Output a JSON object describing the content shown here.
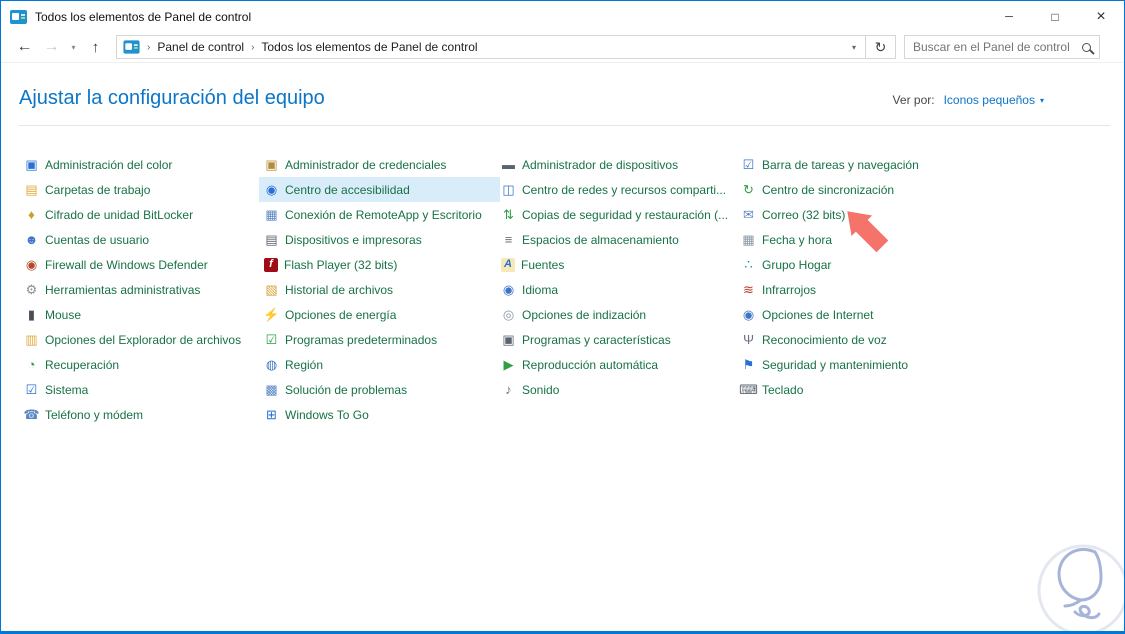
{
  "theme": {
    "accent": "#0078d7",
    "header_text": "#0b76c8",
    "item_text": "#177245",
    "highlight_bg": "#d8ecfa",
    "arrow": "#f4736a"
  },
  "window": {
    "title": "Todos los elementos de Panel de control",
    "controls": {
      "minimize": "─",
      "maximize": "□",
      "close": "×"
    }
  },
  "toolbar": {
    "back_glyph": "←",
    "forward_glyph": "→",
    "recent_caret_glyph": "▾",
    "up_glyph": "↑",
    "address": {
      "separator": "›",
      "crumbs": [
        "Panel de control",
        "Todos los elementos de Panel de control"
      ],
      "caret_glyph": "▾",
      "refresh_glyph": "↻"
    },
    "search": {
      "placeholder": "Buscar en el Panel de control"
    }
  },
  "header": {
    "title": "Ajustar la configuración del equipo",
    "view_by_label": "Ver por:",
    "view_by_value": "Iconos pequeños",
    "view_by_caret": "▾"
  },
  "content": {
    "columns": [
      {
        "items": [
          {
            "id": "administracion-del-color",
            "label": "Administración del color",
            "icon": "color-management-icon",
            "glyph": "▣",
            "fg": "#2a6fd4"
          },
          {
            "id": "carpetas-de-trabajo",
            "label": "Carpetas de trabajo",
            "icon": "work-folders-icon",
            "glyph": "▤",
            "fg": "#e3a93c"
          },
          {
            "id": "cifrado-de-unidad-bitlocker",
            "label": "Cifrado de unidad BitLocker",
            "icon": "bitlocker-lock-key-icon",
            "glyph": "♦",
            "fg": "#c9a227"
          },
          {
            "id": "cuentas-de-usuario",
            "label": "Cuentas de usuario",
            "icon": "user-accounts-icon",
            "glyph": "☻",
            "fg": "#3f75c9"
          },
          {
            "id": "firewall-de-windows-defender",
            "label": "Firewall de Windows Defender",
            "icon": "firewall-globe-icon",
            "glyph": "◉",
            "fg": "#b5482a"
          },
          {
            "id": "herramientas-administrativas",
            "label": "Herramientas administrativas",
            "icon": "admin-tools-gear-icon",
            "glyph": "⚙",
            "fg": "#8a8f98"
          },
          {
            "id": "mouse",
            "label": "Mouse",
            "icon": "mouse-icon",
            "glyph": "▮",
            "fg": "#4a4f57"
          },
          {
            "id": "opciones-del-explorador-de-archivos",
            "label": "Opciones del Explorador de archivos",
            "icon": "file-explorer-options-icon",
            "glyph": "▥",
            "fg": "#e3a93c"
          },
          {
            "id": "recuperacion",
            "label": "Recuperación",
            "icon": "recovery-clock-icon",
            "glyph": "◔",
            "fg": "#2f9e44"
          },
          {
            "id": "sistema",
            "label": "Sistema",
            "icon": "system-monitor-check-icon",
            "glyph": "☑",
            "fg": "#2a6fd4"
          },
          {
            "id": "telefono-y-modem",
            "label": "Teléfono y módem",
            "icon": "phone-modem-icon",
            "glyph": "☎",
            "fg": "#5b87c5"
          }
        ]
      },
      {
        "items": [
          {
            "id": "administrador-de-credenciales",
            "label": "Administrador de credenciales",
            "icon": "credential-manager-safe-icon",
            "glyph": "▣",
            "fg": "#b78a3a"
          },
          {
            "id": "centro-de-accesibilidad",
            "label": "Centro de accesibilidad",
            "icon": "ease-of-access-icon",
            "glyph": "◉",
            "fg": "#2a6fd4",
            "highlighted": true
          },
          {
            "id": "conexion-de-remoteapp-y-escritorio",
            "label": "Conexión de RemoteApp y Escritorio",
            "icon": "remoteapp-desktop-icon",
            "glyph": "▦",
            "fg": "#5b87c5"
          },
          {
            "id": "dispositivos-e-impresoras",
            "label": "Dispositivos e impresoras",
            "icon": "devices-printers-icon",
            "glyph": "▤",
            "fg": "#5a6470"
          },
          {
            "id": "flash-player-32-bits",
            "label": "Flash Player (32 bits)",
            "icon": "flash-player-icon",
            "glyph": "f",
            "fg": "#ffffff",
            "bg": "#9f0c16"
          },
          {
            "id": "historial-de-archivos",
            "label": "Historial de archivos",
            "icon": "file-history-icon",
            "glyph": "▧",
            "fg": "#d9a43c"
          },
          {
            "id": "opciones-de-energia",
            "label": "Opciones de energía",
            "icon": "power-options-plug-icon",
            "glyph": "⚡",
            "fg": "#2f9e44"
          },
          {
            "id": "programas-predeterminados",
            "label": "Programas predeterminados",
            "icon": "default-programs-icon",
            "glyph": "☑",
            "fg": "#2f9e44"
          },
          {
            "id": "region",
            "label": "Región",
            "icon": "region-globe-clock-icon",
            "glyph": "◍",
            "fg": "#3f75c9"
          },
          {
            "id": "solucion-de-problemas",
            "label": "Solución de problemas",
            "icon": "troubleshooting-icon",
            "glyph": "▩",
            "fg": "#5b87c5"
          },
          {
            "id": "windows-to-go",
            "label": "Windows To Go",
            "icon": "windows-to-go-usb-icon",
            "glyph": "⊞",
            "fg": "#2a6fd4"
          }
        ]
      },
      {
        "items": [
          {
            "id": "administrador-de-dispositivos",
            "label": "Administrador de dispositivos",
            "icon": "device-manager-icon",
            "glyph": "▬",
            "fg": "#5a6470"
          },
          {
            "id": "centro-de-redes",
            "label": "Centro de redes y recursos comparti...",
            "icon": "network-sharing-center-icon",
            "glyph": "◫",
            "fg": "#3f75c9"
          },
          {
            "id": "copias-de-seguridad-y-restauracion",
            "label": "Copias de seguridad y restauración (...",
            "icon": "backup-restore-icon",
            "glyph": "⇅",
            "fg": "#2f9e44"
          },
          {
            "id": "espacios-de-almacenamiento",
            "label": "Espacios de almacenamiento",
            "icon": "storage-spaces-icon",
            "glyph": "≡",
            "fg": "#6b7280"
          },
          {
            "id": "fuentes",
            "label": "Fuentes",
            "icon": "fonts-icon",
            "glyph": "A",
            "fg": "#2a6fd4",
            "bg": "#f7e9b5"
          },
          {
            "id": "idioma",
            "label": "Idioma",
            "icon": "language-globe-icon",
            "glyph": "◉",
            "fg": "#3f75c9"
          },
          {
            "id": "opciones-de-indizacion",
            "label": "Opciones de indización",
            "icon": "indexing-options-magnifier-icon",
            "glyph": "◎",
            "fg": "#8a95a5"
          },
          {
            "id": "programas-y-caracteristicas",
            "label": "Programas y características",
            "icon": "programs-features-icon",
            "glyph": "▣",
            "fg": "#5a6470"
          },
          {
            "id": "reproduccion-automatica",
            "label": "Reproducción automática",
            "icon": "autoplay-icon",
            "glyph": "▶",
            "fg": "#2f9e44"
          },
          {
            "id": "sonido",
            "label": "Sonido",
            "icon": "sound-speaker-icon",
            "glyph": "♪",
            "fg": "#6b7280"
          }
        ]
      },
      {
        "items": [
          {
            "id": "barra-de-tareas-y-navegacion",
            "label": "Barra de tareas y navegación",
            "icon": "taskbar-navigation-icon",
            "glyph": "☑",
            "fg": "#3f75c9"
          },
          {
            "id": "centro-de-sincronizacion",
            "label": "Centro de sincronización",
            "icon": "sync-center-icon",
            "glyph": "↻",
            "fg": "#2f9e44"
          },
          {
            "id": "correo-32-bits",
            "label": "Correo (32 bits)",
            "icon": "mail-icon",
            "glyph": "✉",
            "fg": "#5b87c5"
          },
          {
            "id": "fecha-y-hora",
            "label": "Fecha y hora",
            "icon": "date-time-icon",
            "glyph": "▦",
            "fg": "#8a95a5"
          },
          {
            "id": "grupo-hogar",
            "label": "Grupo Hogar",
            "icon": "homegroup-icon",
            "glyph": "∴",
            "fg": "#14919b"
          },
          {
            "id": "infrarrojos",
            "label": "Infrarrojos",
            "icon": "infrared-icon",
            "glyph": "≋",
            "fg": "#c0392b"
          },
          {
            "id": "opciones-de-internet",
            "label": "Opciones de Internet",
            "icon": "internet-options-globe-icon",
            "glyph": "◉",
            "fg": "#3f75c9"
          },
          {
            "id": "reconocimiento-de-voz",
            "label": "Reconocimiento de voz",
            "icon": "speech-recognition-mic-icon",
            "glyph": "Ψ",
            "fg": "#6b7280"
          },
          {
            "id": "seguridad-y-mantenimiento",
            "label": "Seguridad y mantenimiento",
            "icon": "security-maintenance-flag-icon",
            "glyph": "⚑",
            "fg": "#2a6fd4"
          },
          {
            "id": "teclado",
            "label": "Teclado",
            "icon": "keyboard-icon",
            "glyph": "⌨",
            "fg": "#5a6470"
          }
        ]
      }
    ]
  }
}
